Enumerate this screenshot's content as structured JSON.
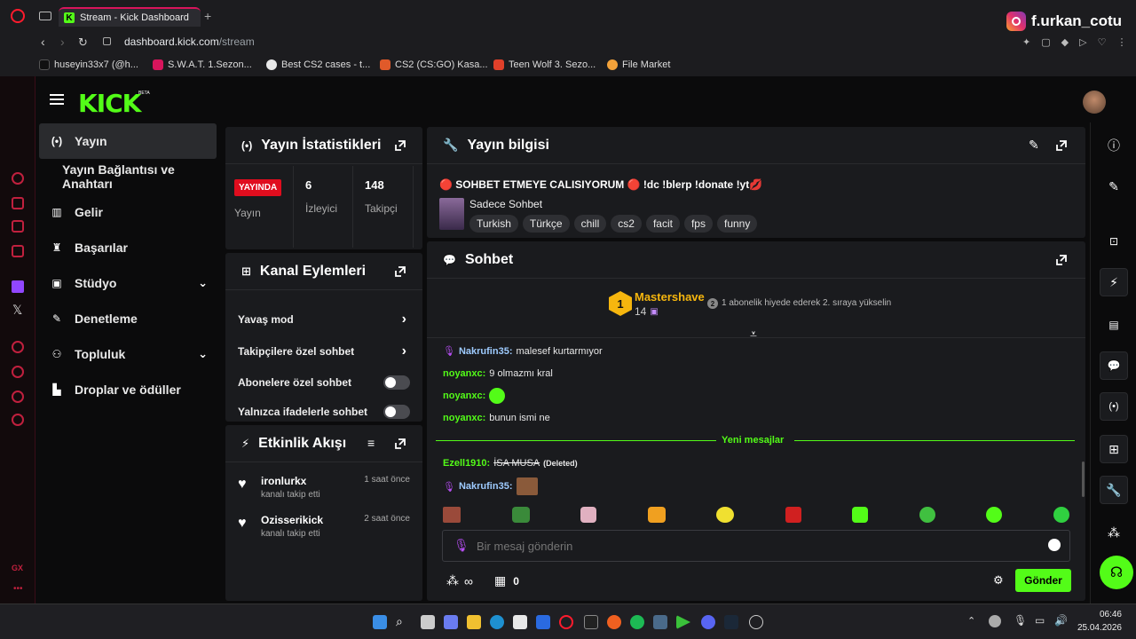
{
  "browser": {
    "tab_title": "Stream - Kick Dashboard",
    "url_domain": "dashboard.kick.com",
    "url_path": "/stream",
    "bookmarks": [
      "huseyin33x7 (@h...",
      "S.W.A.T. 1.Sezon...",
      "Best CS2 cases - t...",
      "CS2 (CS:GO) Kasa...",
      "Teen Wolf 3. Sezo...",
      "File Market"
    ],
    "overlay_handle": "f.urkan_cotu"
  },
  "sidebar": {
    "items": [
      {
        "label": "Yayın",
        "icon": "broadcast-icon"
      },
      {
        "label": "Yayın Bağlantısı ve Anahtarı"
      },
      {
        "label": "Gelir",
        "icon": "chart-icon"
      },
      {
        "label": "Başarılar",
        "icon": "trophy-icon"
      },
      {
        "label": "Stüdyo",
        "icon": "studio-icon"
      },
      {
        "label": "Denetleme",
        "icon": "wrench-icon"
      },
      {
        "label": "Topluluk",
        "icon": "community-icon"
      },
      {
        "label": "Droplar ve ödüller",
        "icon": "drops-icon"
      }
    ]
  },
  "stats": {
    "title": "Yayın İstatistikleri",
    "live_badge": "YAYINDA",
    "live_label": "Yayın",
    "viewers": "6",
    "viewers_label": "İzleyici",
    "followers": "148",
    "followers_label": "Takipçi"
  },
  "actions": {
    "title": "Kanal Eylemleri",
    "items": [
      "Yavaş mod",
      "Takipçilere özel sohbet",
      "Abonelere özel sohbet",
      "Yalnızca ifadelerle sohbet"
    ]
  },
  "activity": {
    "title": "Etkinlik Akışı",
    "items": [
      {
        "user": "ironlurkx",
        "text": "kanalı takip etti",
        "time": "1 saat önce"
      },
      {
        "user": "Ozisserikick",
        "text": "kanalı takip etti",
        "time": "2 saat önce"
      }
    ]
  },
  "info": {
    "title": "Yayın bilgisi",
    "stream_title": "🔴 SOHBET ETMEYE CALISIYORUM 🔴 !dc !blerp !donate !yt💋",
    "category": "Sadece Sohbet",
    "tags": [
      "Turkish",
      "Türkçe",
      "chill",
      "cs2",
      "facit",
      "fps",
      "funny"
    ]
  },
  "chat": {
    "title": "Sohbet",
    "top_gifter": "Mastershave",
    "top_gifter_count": "14",
    "gift_hint": "1 abonelik hiyede ederek 2. sıraya yükselin",
    "rank_badge": "1",
    "hint_rank": "2",
    "messages": [
      {
        "user": "Nakrufin35:",
        "text": "malesef kurtarmıyor"
      },
      {
        "user": "noyanxc:",
        "text": "9 olmazmı kral"
      },
      {
        "user": "noyanxc:",
        "text": ""
      },
      {
        "user": "noyanxc:",
        "text": "bunun ismi ne"
      }
    ],
    "new_messages_label": "Yeni mesajlar",
    "deleted_msg_user": "Ezell1910:",
    "deleted_msg_text": "İSA MUSA",
    "deleted_tag": "(Deleted)",
    "last_user": "Nakrufin35:",
    "input_placeholder": "Bir mesaj gönderin",
    "points": "∞",
    "store_count": "0",
    "send_label": "Gönder"
  },
  "colors": {
    "kick_green": "#53fc18",
    "live_red": "#e00d1e",
    "username_green": "#53fc18",
    "username_blue": "#9ecbff"
  },
  "taskbar": {
    "time": "06:46",
    "date": "25.04.2026"
  }
}
